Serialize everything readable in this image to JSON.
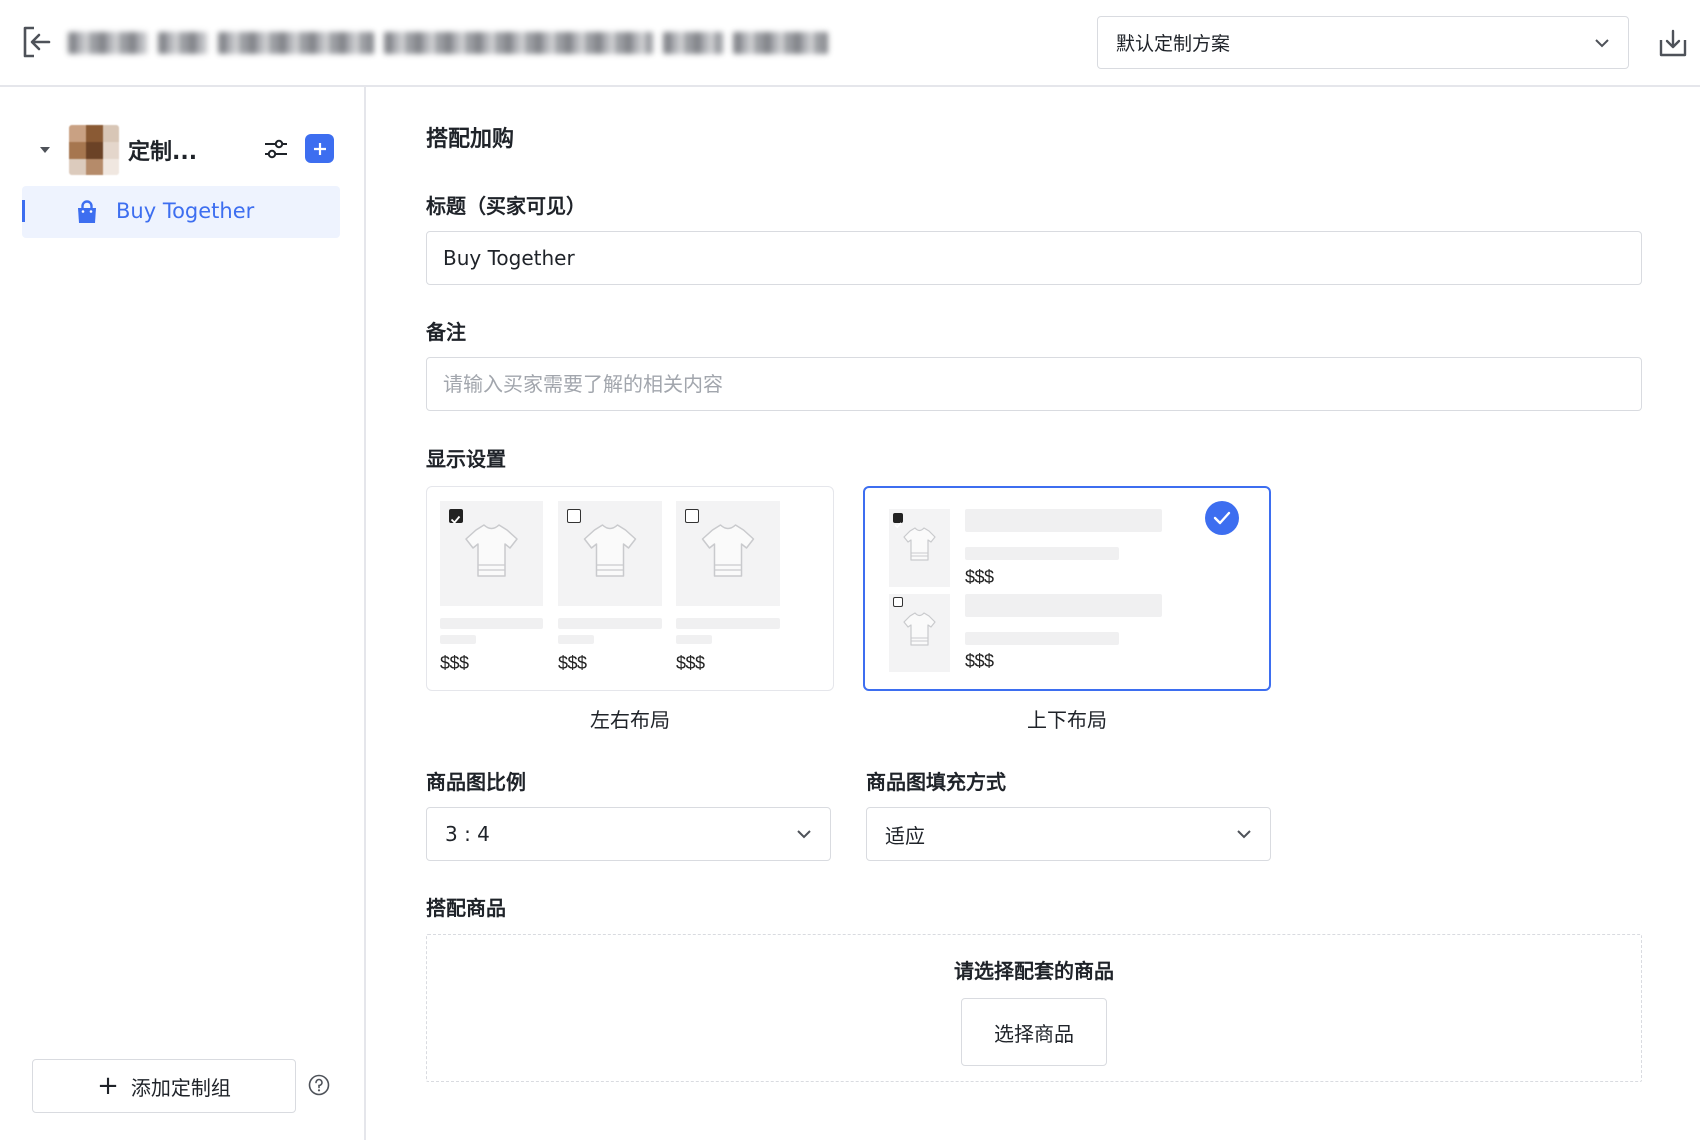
{
  "header": {
    "scheme_select": {
      "value": "默认定制方案"
    }
  },
  "sidebar": {
    "group": {
      "name": "定制..."
    },
    "items": [
      {
        "label": "Buy Together",
        "active": true
      }
    ],
    "add_group_label": "添加定制组"
  },
  "main": {
    "section_title": "搭配加购",
    "title_field": {
      "label": "标题（买家可见）",
      "value": "Buy Together"
    },
    "note_field": {
      "label": "备注",
      "placeholder": "请输入买家需要了解的相关内容"
    },
    "display": {
      "label": "显示设置",
      "price_text": "$$$",
      "options": [
        {
          "caption": "左右布局",
          "selected": false
        },
        {
          "caption": "上下布局",
          "selected": true
        }
      ]
    },
    "ratio": {
      "label": "商品图比例",
      "value": "3 : 4"
    },
    "fill": {
      "label": "商品图填充方式",
      "value": "适应"
    },
    "products": {
      "label": "搭配商品",
      "hint": "请选择配套的商品",
      "button": "选择商品"
    }
  },
  "colors": {
    "accent": "#3d6ef0",
    "border": "#d9dbe0",
    "active_bg": "#eef3fe"
  },
  "icons": [
    "exit-icon",
    "chevron-down-icon",
    "download-icon",
    "caret-down-icon",
    "sliders-icon",
    "plus-icon",
    "shopping-bag-icon",
    "help-icon",
    "checkmark-icon",
    "tshirt-icon"
  ]
}
